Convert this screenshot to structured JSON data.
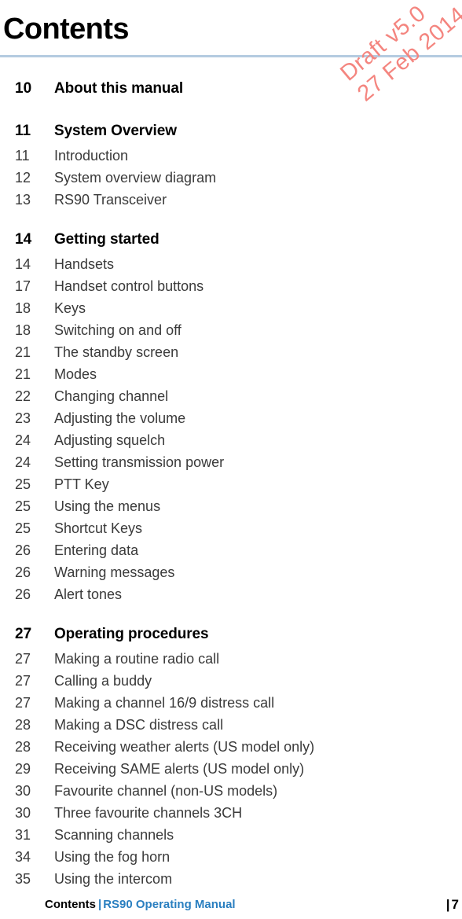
{
  "watermark": {
    "line1": "Draft v5.0",
    "line2": "27 Feb 2014",
    "color": "#f4857f"
  },
  "header": {
    "title": "Contents",
    "rule_color": "#b4cbe0"
  },
  "toc": {
    "rows": [
      {
        "num": "10",
        "label": "About this manual",
        "section": true,
        "gap_before": false
      },
      {
        "num": "11",
        "label": "System Overview",
        "section": true,
        "gap_before": true
      },
      {
        "num": "11",
        "label": "Introduction",
        "section": false,
        "gap_before": false
      },
      {
        "num": "12",
        "label": "System overview diagram",
        "section": false,
        "gap_before": false
      },
      {
        "num": "13",
        "label": "RS90 Transceiver",
        "section": false,
        "gap_before": false
      },
      {
        "num": "14",
        "label": "Getting started",
        "section": true,
        "gap_before": true
      },
      {
        "num": "14",
        "label": "Handsets",
        "section": false,
        "gap_before": false
      },
      {
        "num": "17",
        "label": "Handset control buttons",
        "section": false,
        "gap_before": false
      },
      {
        "num": "18",
        "label": "Keys",
        "section": false,
        "gap_before": false
      },
      {
        "num": "18",
        "label": "Switching on and off",
        "section": false,
        "gap_before": false
      },
      {
        "num": "21",
        "label": "The standby screen",
        "section": false,
        "gap_before": false
      },
      {
        "num": "21",
        "label": "Modes",
        "section": false,
        "gap_before": false
      },
      {
        "num": "22",
        "label": "Changing channel",
        "section": false,
        "gap_before": false
      },
      {
        "num": "23",
        "label": "Adjusting the volume",
        "section": false,
        "gap_before": false
      },
      {
        "num": "24",
        "label": "Adjusting squelch",
        "section": false,
        "gap_before": false
      },
      {
        "num": "24",
        "label": "Setting transmission power",
        "section": false,
        "gap_before": false
      },
      {
        "num": "25",
        "label": "PTT Key",
        "section": false,
        "gap_before": false
      },
      {
        "num": "25",
        "label": "Using the menus",
        "section": false,
        "gap_before": false
      },
      {
        "num": "25",
        "label": "Shortcut Keys",
        "section": false,
        "gap_before": false
      },
      {
        "num": "26",
        "label": "Entering data",
        "section": false,
        "gap_before": false
      },
      {
        "num": "26",
        "label": "Warning messages",
        "section": false,
        "gap_before": false
      },
      {
        "num": "26",
        "label": "Alert tones",
        "section": false,
        "gap_before": false
      },
      {
        "num": "27",
        "label": "Operating procedures",
        "section": true,
        "gap_before": true
      },
      {
        "num": "27",
        "label": "Making a routine radio call",
        "section": false,
        "gap_before": false
      },
      {
        "num": "27",
        "label": "Calling a buddy",
        "section": false,
        "gap_before": false
      },
      {
        "num": "27",
        "label": "Making a channel 16/9 distress call",
        "section": false,
        "gap_before": false
      },
      {
        "num": "28",
        "label": "Making a DSC distress call",
        "section": false,
        "gap_before": false
      },
      {
        "num": "28",
        "label": "Receiving weather alerts (US model only)",
        "section": false,
        "gap_before": false
      },
      {
        "num": "29",
        "label": "Receiving SAME alerts (US model only)",
        "section": false,
        "gap_before": false
      },
      {
        "num": "30",
        "label": "Favourite channel (non-US models)",
        "section": false,
        "gap_before": false
      },
      {
        "num": "30",
        "label": "Three favourite channels 3CH",
        "section": false,
        "gap_before": false
      },
      {
        "num": "31",
        "label": "Scanning channels",
        "section": false,
        "gap_before": false
      },
      {
        "num": "34",
        "label": "Using the fog horn",
        "section": false,
        "gap_before": false
      },
      {
        "num": "35",
        "label": "Using the intercom",
        "section": false,
        "gap_before": false
      }
    ]
  },
  "footer": {
    "section": "Contents",
    "separator": "|",
    "manual": "RS90 Operating Manual",
    "page_bar": "|",
    "page_number": "7",
    "accent_color": "#2a7fc0"
  }
}
